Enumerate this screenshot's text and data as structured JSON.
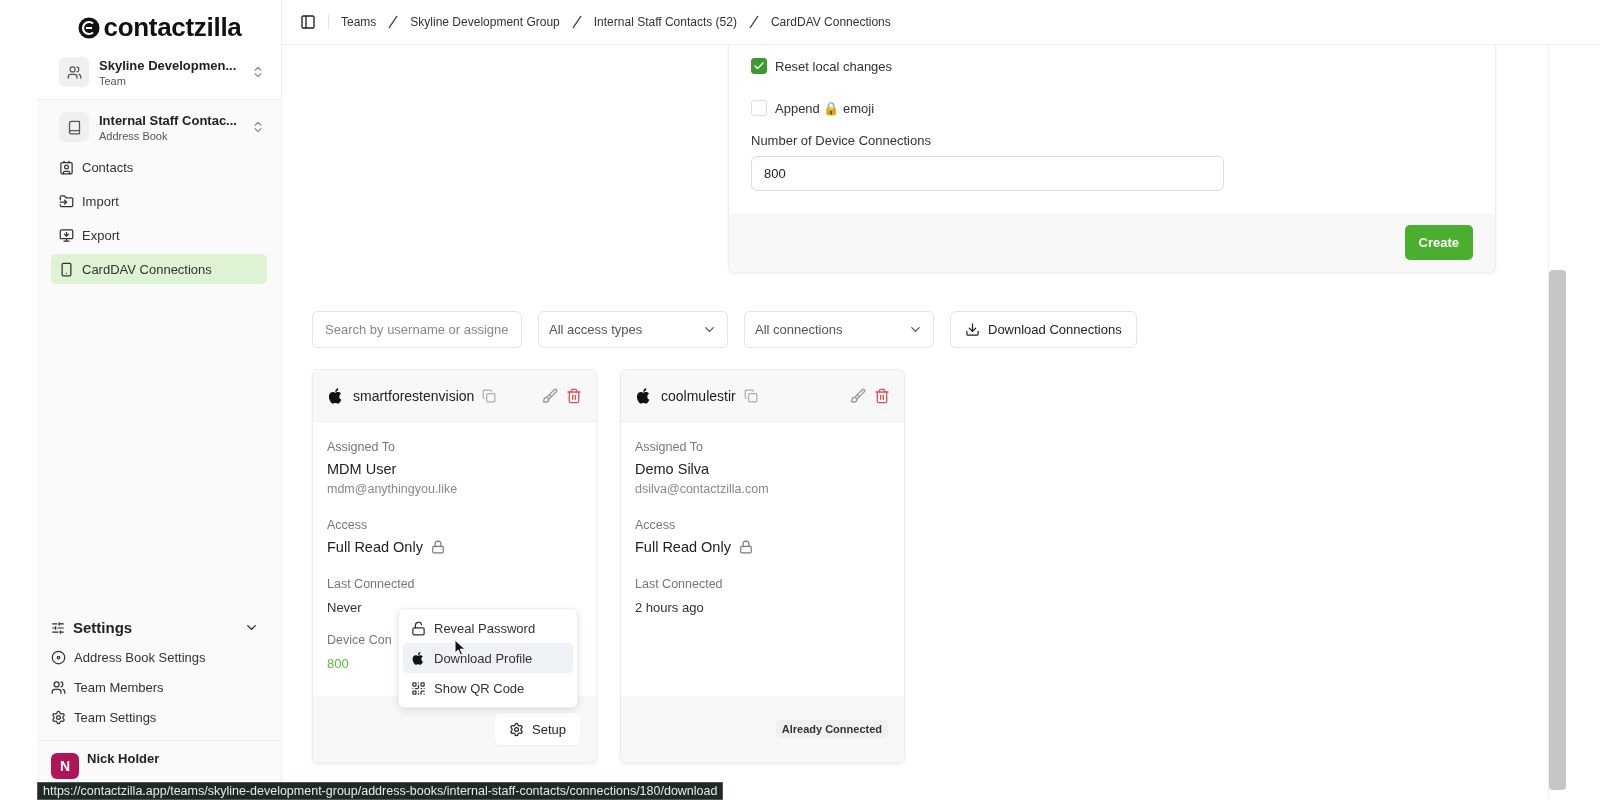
{
  "sidebar": {
    "logo": "contactzilla",
    "team": {
      "name": "Skyline Developmen...",
      "sub": "Team"
    },
    "address_book": {
      "name": "Internal Staff Contac...",
      "sub": "Address Book"
    },
    "nav": [
      {
        "label": "Contacts",
        "selected": false
      },
      {
        "label": "Import",
        "selected": false
      },
      {
        "label": "Export",
        "selected": false
      },
      {
        "label": "CardDAV Connections",
        "selected": true
      }
    ],
    "settings": {
      "title": "Settings",
      "expanded": true,
      "items": [
        {
          "label": "Address Book Settings"
        },
        {
          "label": "Team Members"
        },
        {
          "label": "Team Settings"
        }
      ]
    },
    "user": {
      "initial": "N",
      "name": "Nick Holder"
    }
  },
  "breadcrumbs": [
    "Teams",
    "Skyline Development Group",
    "Internal Staff Contacts (52)",
    "CardDAV Connections"
  ],
  "form": {
    "options": [
      {
        "label": "Reset local changes",
        "checked": true
      },
      {
        "label": "Append 🔒 emoji",
        "checked": false
      }
    ],
    "field_label": "Number of Device Connections",
    "field_value": "800",
    "submit": "Create"
  },
  "filters": {
    "search_placeholder": "Search by username or assigne",
    "access": "All access types",
    "connections": "All connections",
    "download": "Download Connections"
  },
  "cards": [
    {
      "username": "smartforestenvision",
      "assigned_label": "Assigned To",
      "name": "MDM User",
      "email": "mdm@anythingyou.like",
      "access_label": "Access",
      "access": "Full Read Only",
      "last_label": "Last Connected",
      "last": "Never",
      "device_label": "Device Con",
      "device_value": "800",
      "footer": {
        "kind": "button",
        "text": "Setup"
      },
      "menu": [
        {
          "label": "Reveal Password",
          "selected": false
        },
        {
          "label": "Download Profile",
          "selected": true
        },
        {
          "label": "Show QR Code",
          "selected": false
        }
      ]
    },
    {
      "username": "coolmulestir",
      "assigned_label": "Assigned To",
      "name": "Demo Silva",
      "email": "dsilva@contactzilla.com",
      "access_label": "Access",
      "access": "Full Read Only",
      "last_label": "Last Connected",
      "last": "2 hours ago",
      "footer": {
        "kind": "badge",
        "text": "Already Connected"
      }
    }
  ],
  "status_url": "https://contactzilla.app/teams/skyline-development-group/address-books/internal-staff-contacts/connections/180/download"
}
